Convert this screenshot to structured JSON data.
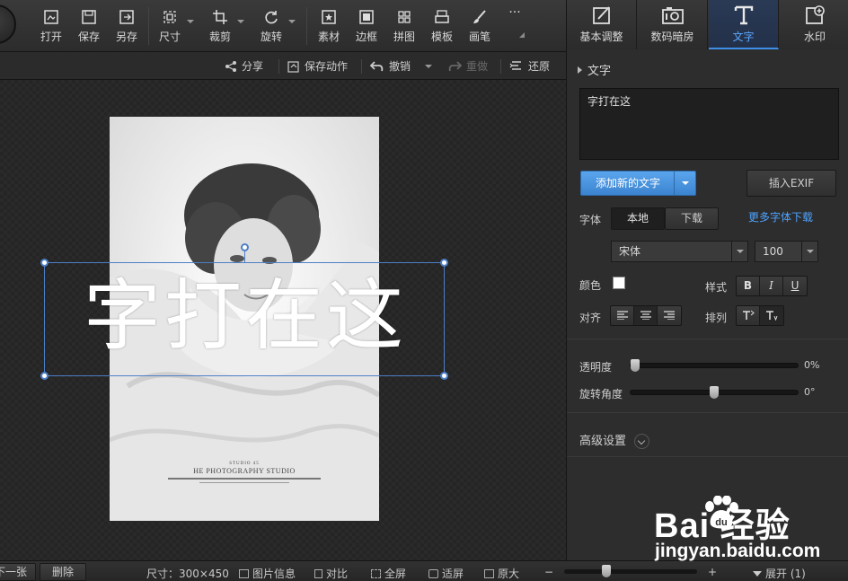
{
  "toolbar": {
    "items": [
      {
        "label": "打开",
        "icon": "open-icon"
      },
      {
        "label": "保存",
        "icon": "save-icon"
      },
      {
        "label": "另存",
        "icon": "save-as-icon"
      },
      {
        "label": "尺寸",
        "icon": "resize-icon"
      },
      {
        "label": "裁剪",
        "icon": "crop-icon"
      },
      {
        "label": "旋转",
        "icon": "rotate-icon"
      },
      {
        "label": "素材",
        "icon": "material-icon"
      },
      {
        "label": "边框",
        "icon": "border-icon"
      },
      {
        "label": "拼图",
        "icon": "puzzle-icon"
      },
      {
        "label": "模板",
        "icon": "template-icon"
      },
      {
        "label": "画笔",
        "icon": "brush-icon"
      }
    ],
    "more": "···"
  },
  "tabs": [
    {
      "label": "基本调整",
      "icon": "basic-adjust-icon"
    },
    {
      "label": "数码暗房",
      "icon": "camera-icon"
    },
    {
      "label": "文字",
      "icon": "text-icon",
      "active": true
    },
    {
      "label": "水印",
      "icon": "watermark-icon"
    }
  ],
  "actions": {
    "share": "分享",
    "save_action": "保存动作",
    "undo": "撤销",
    "redo": "重做",
    "restore": "还原"
  },
  "canvas": {
    "overlay_text": "字打在这",
    "photo_studio_small": "STUDIO 45",
    "photo_studio": "HE PHOTOGRAPHY STUDIO"
  },
  "panel": {
    "section_title": "文字",
    "text_value": "字打在这",
    "add_text_button": "添加新的文字",
    "insert_exif_button": "插入EXIF",
    "font_label": "字体",
    "font_source_local": "本地",
    "font_source_download": "下载",
    "more_fonts_link": "更多字体下载",
    "font_name": "宋体",
    "font_size": "100",
    "color_label": "颜色",
    "text_color": "#ffffff",
    "style_label": "样式",
    "style_buttons": [
      "B",
      "I",
      "U"
    ],
    "align_label": "对齐",
    "arrange_label": "排列",
    "opacity_label": "透明度",
    "opacity_value": "0%",
    "opacity_fraction": 0,
    "rotation_label": "旋转角度",
    "rotation_value": "0°",
    "rotation_fraction": 0.5,
    "advanced_label": "高级设置"
  },
  "statusbar": {
    "prev": "下一张",
    "delete": "删除",
    "size_label": "尺寸：300×450",
    "image_info": "图片信息",
    "compare": "对比",
    "fullscreen": "全屏",
    "fit": "适屏",
    "original": "原大",
    "zoom_minus": "−",
    "zoom_plus": "+",
    "expand": "展开 (1)"
  },
  "watermark": {
    "logo": "Bai   经验",
    "url": "jingyan.baidu.com"
  },
  "colors": {
    "accent": "#3f8fe8",
    "link": "#4da3ff",
    "button_blue": "#4a95e0"
  }
}
